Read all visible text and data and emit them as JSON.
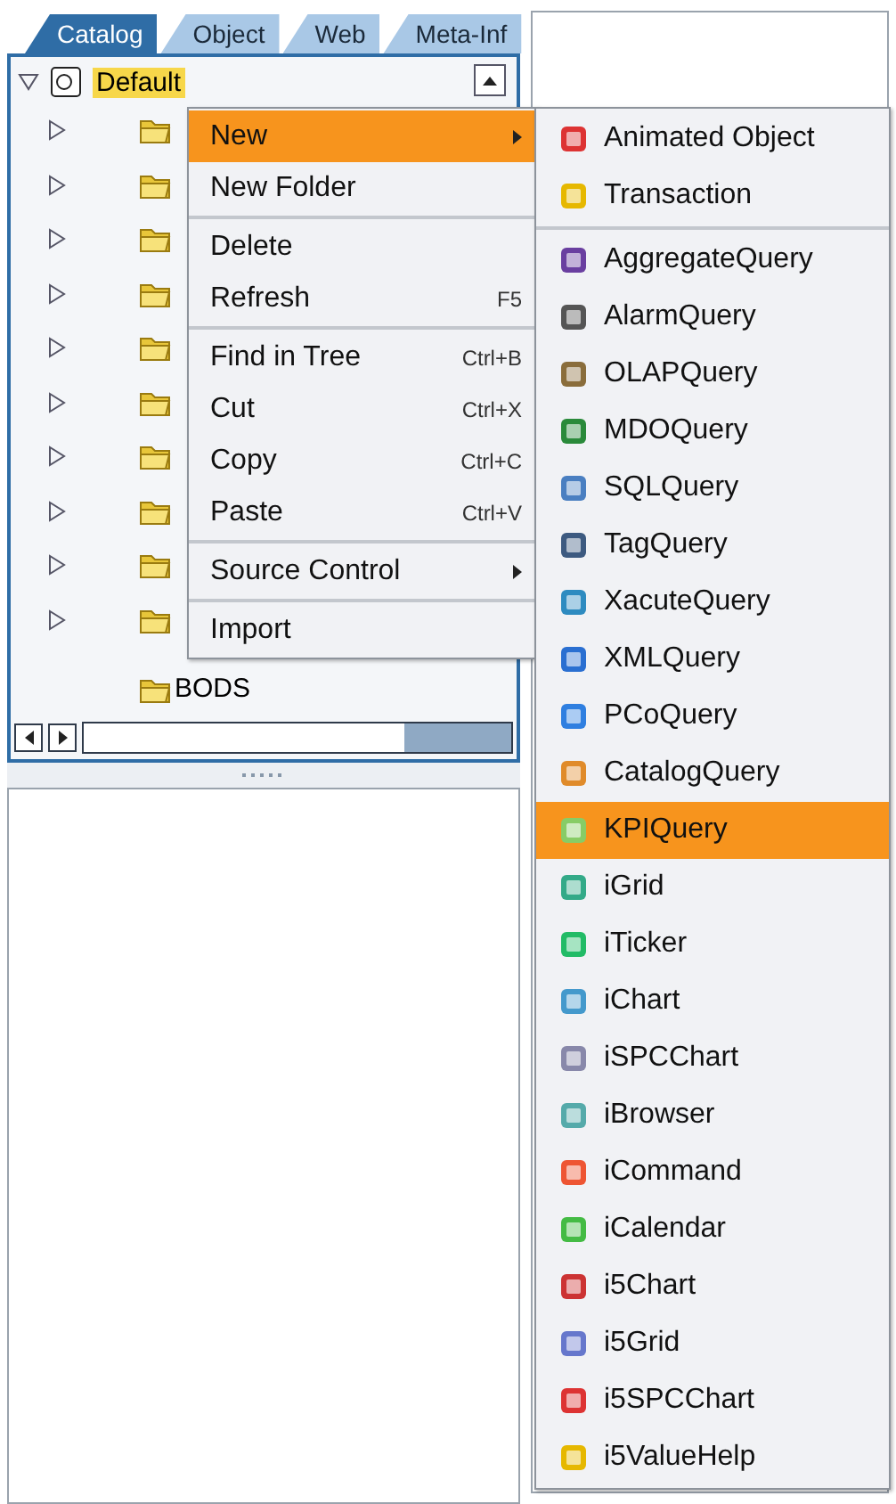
{
  "tabs": [
    {
      "label": "Catalog",
      "selected": true
    },
    {
      "label": "Object",
      "selected": false
    },
    {
      "label": "Web",
      "selected": false
    },
    {
      "label": "Meta-Inf",
      "selected": false
    }
  ],
  "tree": {
    "label": "Default",
    "expanded": true,
    "selected": true,
    "children": [
      {
        "expandable": true
      },
      {
        "expandable": true
      },
      {
        "expandable": true
      },
      {
        "expandable": true
      },
      {
        "expandable": true
      },
      {
        "expandable": true
      },
      {
        "expandable": true
      },
      {
        "expandable": true
      },
      {
        "expandable": true
      },
      {
        "expandable": true
      },
      {
        "label": "BODS",
        "expandable": false
      }
    ]
  },
  "context_menu": {
    "items": [
      {
        "kind": "item",
        "label": "New",
        "submenu": true,
        "selected": true
      },
      {
        "kind": "item",
        "label": "New Folder",
        "submenu": false,
        "selected": false
      },
      {
        "kind": "separator"
      },
      {
        "kind": "item",
        "label": "Delete",
        "submenu": false,
        "selected": false
      },
      {
        "kind": "item",
        "label": "Refresh",
        "shortcut": "F5",
        "submenu": false,
        "selected": false
      },
      {
        "kind": "separator"
      },
      {
        "kind": "item",
        "label": "Find in Tree",
        "shortcut": "Ctrl+B",
        "submenu": false,
        "selected": false
      },
      {
        "kind": "item",
        "label": "Cut",
        "shortcut": "Ctrl+X",
        "submenu": false,
        "selected": false
      },
      {
        "kind": "item",
        "label": "Copy",
        "shortcut": "Ctrl+C",
        "submenu": false,
        "selected": false
      },
      {
        "kind": "item",
        "label": "Paste",
        "shortcut": "Ctrl+V",
        "submenu": false,
        "selected": false
      },
      {
        "kind": "separator"
      },
      {
        "kind": "item",
        "label": "Source Control",
        "submenu": true,
        "selected": false
      },
      {
        "kind": "separator"
      },
      {
        "kind": "item",
        "label": "Import",
        "submenu": false,
        "selected": false
      }
    ]
  },
  "submenu": {
    "items": [
      {
        "kind": "item",
        "label": "Animated Object",
        "selected": false
      },
      {
        "kind": "item",
        "label": "Transaction",
        "selected": false
      },
      {
        "kind": "separator"
      },
      {
        "kind": "item",
        "label": "AggregateQuery",
        "selected": false
      },
      {
        "kind": "item",
        "label": "AlarmQuery",
        "selected": false
      },
      {
        "kind": "item",
        "label": "OLAPQuery",
        "selected": false
      },
      {
        "kind": "item",
        "label": "MDOQuery",
        "selected": false
      },
      {
        "kind": "item",
        "label": "SQLQuery",
        "selected": false
      },
      {
        "kind": "item",
        "label": "TagQuery",
        "selected": false
      },
      {
        "kind": "item",
        "label": "XacuteQuery",
        "selected": false
      },
      {
        "kind": "item",
        "label": "XMLQuery",
        "selected": false
      },
      {
        "kind": "item",
        "label": "PCoQuery",
        "selected": false
      },
      {
        "kind": "item",
        "label": "CatalogQuery",
        "selected": false
      },
      {
        "kind": "item",
        "label": "KPIQuery",
        "selected": true
      },
      {
        "kind": "item",
        "label": "iGrid",
        "selected": false
      },
      {
        "kind": "item",
        "label": "iTicker",
        "selected": false
      },
      {
        "kind": "item",
        "label": "iChart",
        "selected": false
      },
      {
        "kind": "item",
        "label": "iSPCChart",
        "selected": false
      },
      {
        "kind": "item",
        "label": "iBrowser",
        "selected": false
      },
      {
        "kind": "item",
        "label": "iCommand",
        "selected": false
      },
      {
        "kind": "item",
        "label": "iCalendar",
        "selected": false
      },
      {
        "kind": "item",
        "label": "i5Chart",
        "selected": false
      },
      {
        "kind": "item",
        "label": "i5Grid",
        "selected": false
      },
      {
        "kind": "item",
        "label": "i5SPCChart",
        "selected": false
      },
      {
        "kind": "item",
        "label": "i5ValueHelp",
        "selected": false
      }
    ]
  }
}
